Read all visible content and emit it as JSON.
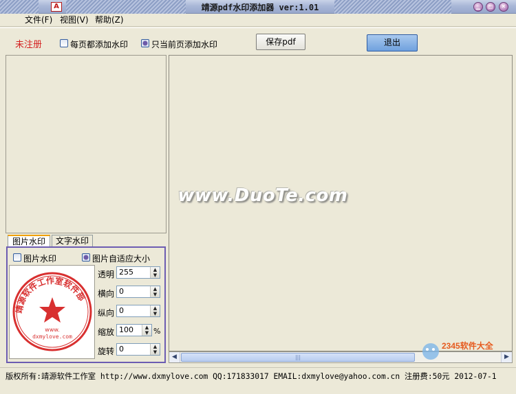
{
  "window": {
    "title": "靖源pdf水印添加器 ver:1.01",
    "app_icon": "pdf-icon"
  },
  "menu": {
    "items": [
      {
        "label": "文件(F)"
      },
      {
        "label": "视图(V)"
      },
      {
        "label": "帮助(Z)"
      }
    ]
  },
  "toolbar": {
    "registration_status": "未注册",
    "every_page_label": "每页都添加水印",
    "every_page_checked": false,
    "current_page_label": "只当前页添加水印",
    "current_page_checked": true,
    "save_pdf_label": "保存pdf",
    "exit_label": "退出"
  },
  "preview": {
    "watermark_overlay": "www.DuoTe.com"
  },
  "tabs": [
    {
      "label": "图片水印",
      "active": true
    },
    {
      "label": "文字水印",
      "active": false
    }
  ],
  "image_watermark": {
    "enable_label": "图片水印",
    "enable_checked": false,
    "auto_fit_label": "图片自适应大小",
    "auto_fit_checked": true,
    "seal": {
      "text": "靖源软件工作室软件部",
      "url": "dxmylove.com",
      "center": "www.",
      "color": "#d83030"
    },
    "fields": {
      "opacity_label": "透明",
      "opacity_value": "255",
      "horizontal_label": "横向",
      "horizontal_value": "0",
      "vertical_label": "纵向",
      "vertical_value": "0",
      "scale_label": "缩放",
      "scale_value": "100",
      "scale_unit": "%",
      "rotate_label": "旋转",
      "rotate_value": "0"
    }
  },
  "status": {
    "text": "版权所有:靖源软件工作室 http://www.dxmylove.com QQ:171833017 EMAIL:dxmylove@yahoo.com.cn 注册费:50元 2012-07-1"
  },
  "corner_logo": {
    "text": "2345软件大全"
  }
}
